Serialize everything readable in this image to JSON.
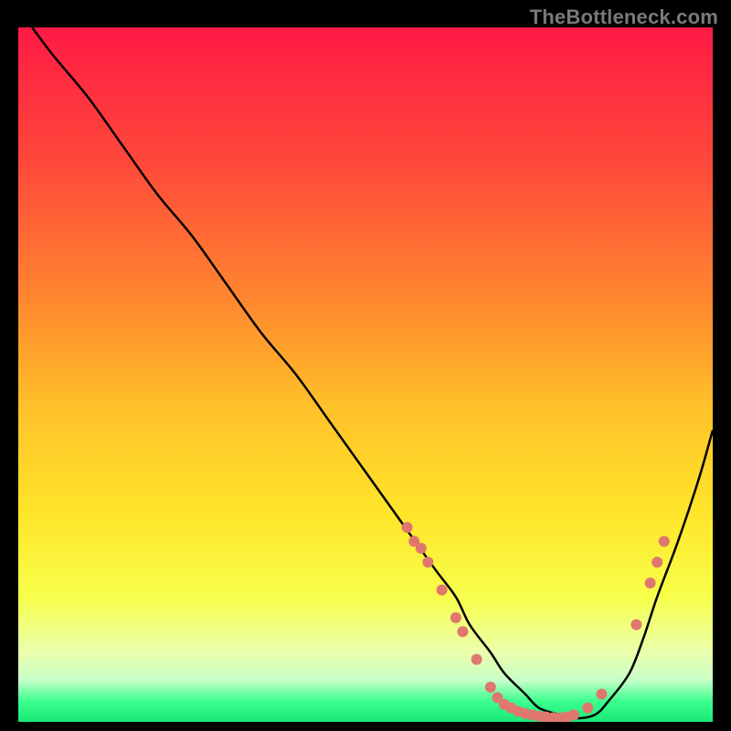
{
  "watermark": "TheBottleneck.com",
  "chart_data": {
    "type": "line",
    "title": "",
    "xlabel": "",
    "ylabel": "",
    "xlim": [
      0,
      100
    ],
    "ylim": [
      0,
      100
    ],
    "series": [
      {
        "name": "curve",
        "color": "#000000",
        "x": [
          2,
          5,
          10,
          15,
          20,
          25,
          30,
          35,
          40,
          45,
          50,
          55,
          60,
          63,
          65,
          68,
          70,
          73,
          75,
          78,
          80,
          83,
          85,
          88,
          90,
          92,
          95,
          98,
          100
        ],
        "y": [
          100,
          96,
          90,
          83,
          76,
          70,
          63,
          56,
          50,
          43,
          36,
          29,
          22,
          18,
          14,
          10,
          7,
          4,
          2,
          1,
          0.5,
          1,
          3,
          7,
          12,
          18,
          26,
          35,
          42
        ]
      }
    ],
    "markers": {
      "name": "highlighted-points",
      "color": "#e0776f",
      "radius_px": 6,
      "points": [
        {
          "x": 56,
          "y": 28
        },
        {
          "x": 57,
          "y": 26
        },
        {
          "x": 58,
          "y": 25
        },
        {
          "x": 59,
          "y": 23
        },
        {
          "x": 61,
          "y": 19
        },
        {
          "x": 63,
          "y": 15
        },
        {
          "x": 64,
          "y": 13
        },
        {
          "x": 66,
          "y": 9
        },
        {
          "x": 68,
          "y": 5
        },
        {
          "x": 69,
          "y": 3.5
        },
        {
          "x": 70,
          "y": 2.5
        },
        {
          "x": 71,
          "y": 2
        },
        {
          "x": 72,
          "y": 1.5
        },
        {
          "x": 73,
          "y": 1.2
        },
        {
          "x": 74,
          "y": 1
        },
        {
          "x": 75,
          "y": 0.8
        },
        {
          "x": 76,
          "y": 0.7
        },
        {
          "x": 77,
          "y": 0.6
        },
        {
          "x": 78,
          "y": 0.6
        },
        {
          "x": 79,
          "y": 0.7
        },
        {
          "x": 80,
          "y": 1
        },
        {
          "x": 82,
          "y": 2
        },
        {
          "x": 84,
          "y": 4
        },
        {
          "x": 89,
          "y": 14
        },
        {
          "x": 91,
          "y": 20
        },
        {
          "x": 92,
          "y": 23
        },
        {
          "x": 93,
          "y": 26
        }
      ]
    },
    "gradient_stops": [
      {
        "pos": 0.0,
        "color": "#ff1a44"
      },
      {
        "pos": 0.2,
        "color": "#ff4a3a"
      },
      {
        "pos": 0.4,
        "color": "#ff8a2e"
      },
      {
        "pos": 0.55,
        "color": "#ffc22a"
      },
      {
        "pos": 0.7,
        "color": "#ffe52a"
      },
      {
        "pos": 0.82,
        "color": "#f7ff4a"
      },
      {
        "pos": 0.9,
        "color": "#eaffad"
      },
      {
        "pos": 0.94,
        "color": "#c8ffc8"
      },
      {
        "pos": 0.97,
        "color": "#3dff8f"
      },
      {
        "pos": 1.0,
        "color": "#18e877"
      }
    ]
  }
}
